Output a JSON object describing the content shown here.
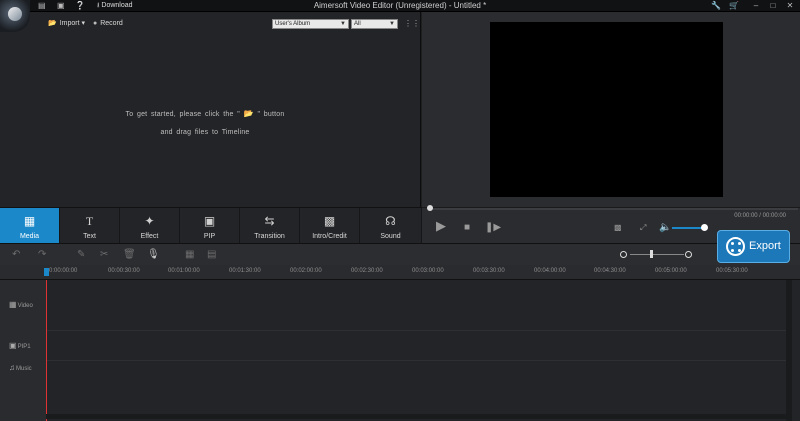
{
  "window": {
    "title": "Aimersoft Video Editor (Unregistered) - Untitled *",
    "download_label": "Download"
  },
  "media": {
    "import_label": "Import",
    "record_label": "Record",
    "album_select": "User's Album",
    "filter_select": "All",
    "hint_line1_before": "To get started, please click the \"",
    "hint_line1_after": "\" button",
    "hint_line2": "and drag files to Timeline"
  },
  "tabs": [
    {
      "label": "Media",
      "icon": "media-icon",
      "active": true
    },
    {
      "label": "Text",
      "icon": "text-icon",
      "active": false
    },
    {
      "label": "Effect",
      "icon": "effect-wand-icon",
      "active": false
    },
    {
      "label": "PIP",
      "icon": "pip-icon",
      "active": false
    },
    {
      "label": "Transition",
      "icon": "transition-icon",
      "active": false
    },
    {
      "label": "Intro/Credit",
      "icon": "intro-credit-icon",
      "active": false
    },
    {
      "label": "Sound",
      "icon": "headphones-icon",
      "active": false
    }
  ],
  "player": {
    "time": "00:00:00 / 00:00:00",
    "volume_level": 0.9
  },
  "export_label": "Export",
  "timeline": {
    "ruler": [
      "0:00:00:00",
      "00:00:30:00",
      "00:01:00:00",
      "00:01:30:00",
      "00:02:00:00",
      "00:02:30:00",
      "00:03:00:00",
      "00:03:30:00",
      "00:04:00:00",
      "00:04:30:00",
      "00:05:00:00",
      "00:05:30:00"
    ],
    "tracks": [
      {
        "label": "Video",
        "icon": "film-icon"
      },
      {
        "label": "PIP1",
        "icon": "pip-track-icon"
      },
      {
        "label": "Music",
        "icon": "music-note-icon"
      }
    ]
  }
}
